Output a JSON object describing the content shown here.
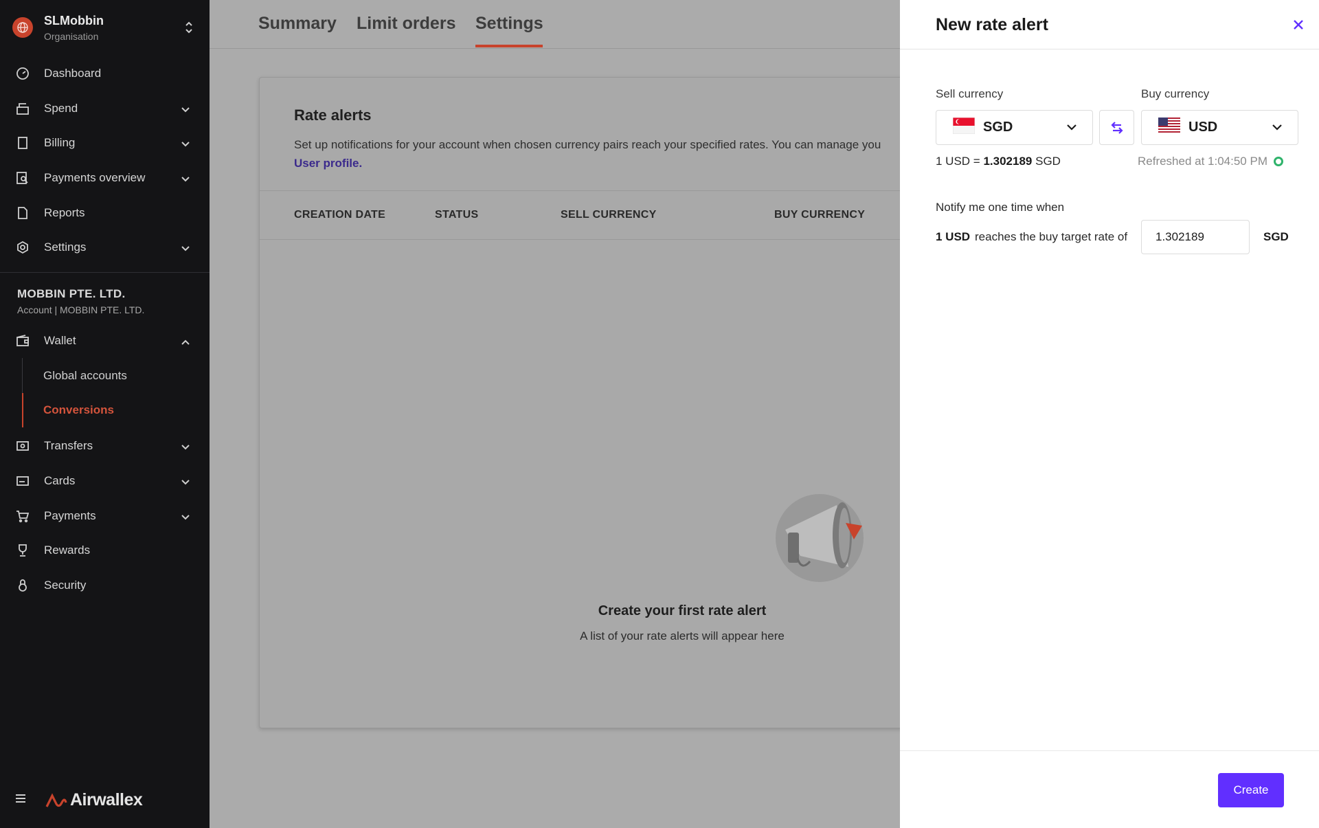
{
  "org": {
    "name": "SLMobbin",
    "sub": "Organisation"
  },
  "nav": {
    "dashboard": "Dashboard",
    "spend": "Spend",
    "billing": "Billing",
    "payments_overview": "Payments overview",
    "reports": "Reports",
    "settings": "Settings"
  },
  "account": {
    "name": "MOBBIN PTE. LTD.",
    "sub": "Account | MOBBIN PTE. LTD."
  },
  "wallet": {
    "label": "Wallet",
    "sub_items": [
      "Global accounts",
      "Conversions"
    ]
  },
  "nav2": {
    "transfers": "Transfers",
    "cards": "Cards",
    "payments": "Payments",
    "rewards": "Rewards",
    "security": "Security"
  },
  "brand": {
    "name": "Airwallex"
  },
  "tabs": [
    "Summary",
    "Limit orders",
    "Settings"
  ],
  "card": {
    "title": "Rate alerts",
    "desc": "Set up notifications for your account when chosen currency pairs reach your specified rates. You can manage you",
    "link": "User profile.",
    "columns": [
      "CREATION DATE",
      "STATUS",
      "SELL CURRENCY",
      "BUY CURRENCY"
    ],
    "empty_title": "Create your first rate alert",
    "empty_sub": "A list of your rate alerts will appear here"
  },
  "drawer": {
    "title": "New rate alert",
    "sell_label": "Sell currency",
    "buy_label": "Buy currency",
    "sell_code": "SGD",
    "buy_code": "USD",
    "rate_prefix": "1 USD =",
    "rate_value": "1.302189",
    "rate_suffix": "SGD",
    "refreshed": "Refreshed at 1:04:50 PM",
    "notify_label": "Notify me one time when",
    "target_base": "1 USD",
    "target_text": "reaches the buy target rate of",
    "target_value": "1.302189",
    "target_quote": "SGD",
    "create_label": "Create"
  },
  "colors": {
    "accent": "#612fff",
    "brand": "#c8432c",
    "success": "#2fb36b"
  }
}
